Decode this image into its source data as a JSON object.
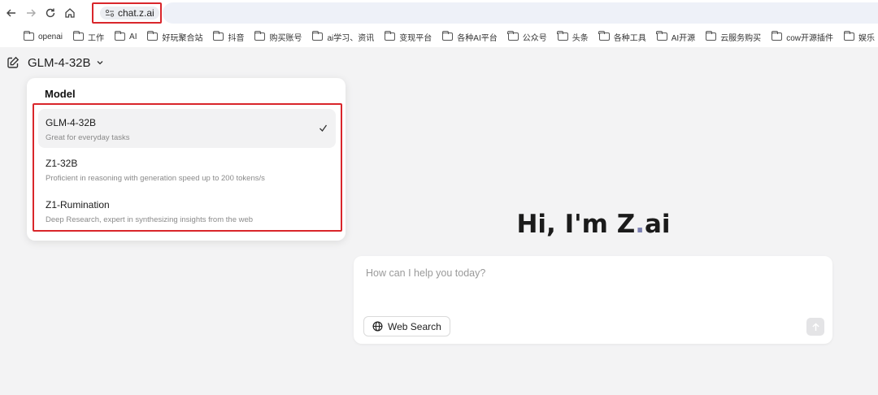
{
  "browser": {
    "url": "chat.z.ai"
  },
  "bookmarks": [
    "openai",
    "工作",
    "AI",
    "好玩聚合站",
    "抖音",
    "购买账号",
    "ai学习、资讯",
    "变现平台",
    "各种AI平台",
    "公众号",
    "头条",
    "各种工具",
    "AI开源",
    "云服务购买",
    "cow开源插件",
    "娱乐"
  ],
  "header": {
    "model": "GLM-4-32B"
  },
  "dropdown": {
    "title": "Model",
    "options": [
      {
        "name": "GLM-4-32B",
        "desc": "Great for everyday tasks",
        "selected": true
      },
      {
        "name": "Z1-32B",
        "desc": "Proficient in reasoning with generation speed up to 200 tokens/s",
        "selected": false
      },
      {
        "name": "Z1-Rumination",
        "desc": "Deep Research, expert in synthesizing insights from the web",
        "selected": false
      }
    ]
  },
  "main": {
    "greeting_prefix": "Hi, I'm Z",
    "greeting_dot": ".",
    "greeting_suffix": "ai",
    "input_placeholder": "How can I help you today?",
    "web_search_label": "Web Search"
  },
  "colors": {
    "highlight_border": "#d9262b",
    "accent_dot": "#7a7fb0"
  }
}
